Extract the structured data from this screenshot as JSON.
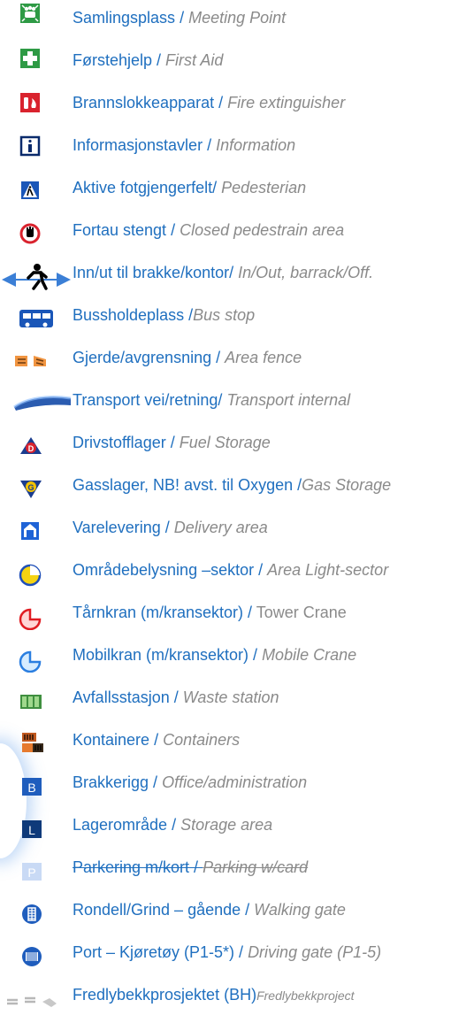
{
  "legend": {
    "items": [
      {
        "icon": "meeting-point-icon",
        "no": "Samlingsplass",
        "sep": " / ",
        "en": "Meeting Point"
      },
      {
        "icon": "first-aid-icon",
        "no": "Førstehjelp",
        "sep": " / ",
        "en": "First Aid"
      },
      {
        "icon": "fire-extinguisher-icon",
        "no": "Brannslokkeapparat",
        "sep": " / ",
        "en": "Fire extinguisher"
      },
      {
        "icon": "information-icon",
        "no": "Informasjonstavler",
        "sep": " / ",
        "en": "Information"
      },
      {
        "icon": "pedestrian-crossing-icon",
        "no": " Aktive fotgjengerfelt",
        "sep": "/ ",
        "en": "Pedesterian"
      },
      {
        "icon": "closed-pedestrian-icon",
        "no": "Fortau stengt",
        "sep": " / ",
        "en": "Closed pedestrain area"
      },
      {
        "icon": "walking-person-arrows-icon",
        "no": "Inn/ut til brakke/kontor",
        "sep": "/ ",
        "en": "In/Out, barrack/Off."
      },
      {
        "icon": "bus-icon",
        "no": "Bussholdeplass",
        "sep": " /",
        "en": "Bus stop"
      },
      {
        "icon": "fence-icon",
        "no": "Gjerde/avgrensning",
        "sep": " / ",
        "en": "Area fence"
      },
      {
        "icon": "transport-road-icon",
        "no": "Transport vei/retning",
        "sep": "/ ",
        "en": "Transport internal"
      },
      {
        "icon": "fuel-storage-icon",
        "no": "Drivstofflager",
        "sep": " / ",
        "en": "Fuel Storage"
      },
      {
        "icon": "gas-storage-icon",
        "no": "Gasslager, NB! avst. til Oxygen",
        "sep": " /",
        "en": "Gas Storage"
      },
      {
        "icon": "delivery-icon",
        "no": "Varelevering",
        "sep": " / ",
        "en": "Delivery area"
      },
      {
        "icon": "area-light-icon",
        "no": "Områdebelysning –sektor",
        "sep": " / ",
        "en": "Area Light-sector"
      },
      {
        "icon": "tower-crane-icon",
        "no": "Tårnkran (m/kransektor)",
        "sep": " / ",
        "en": "Tower Crane"
      },
      {
        "icon": "mobile-crane-icon",
        "no": "Mobilkran (m/kransektor)",
        "sep": " / ",
        "en": "Mobile Crane"
      },
      {
        "icon": "waste-station-icon",
        "no": "Avfallsstasjon",
        "sep": " / ",
        "en": "Waste station"
      },
      {
        "icon": "containers-icon",
        "no": "Kontainere",
        "sep": " / ",
        "en": "Containers"
      },
      {
        "icon": "office-b-icon",
        "letter": "B",
        "no": "Brakkerigg",
        "sep": " / ",
        "en": "Office/administration"
      },
      {
        "icon": "storage-l-icon",
        "letter": "L",
        "no": "Lagerområde",
        "sep": " / ",
        "en": "Storage area"
      },
      {
        "icon": "parking-p-icon",
        "letter": "P",
        "no": "Parkering m/kort",
        "sep": " / ",
        "en": "Parking w/card"
      },
      {
        "icon": "walking-gate-icon",
        "no": "Rondell/Grind – gående",
        "sep": " / ",
        "en": "Walking gate"
      },
      {
        "icon": "driving-gate-icon",
        "no": "Port – Kjøretøy (P1-5*)",
        "sep": " / ",
        "en": "Driving gate (P1-5)"
      },
      {
        "icon": "project-boundary-icon",
        "no": "Fredlybekkprosjektet (BH)",
        "sep": "",
        "en": "Fredlybekkproject"
      }
    ]
  },
  "colors": {
    "label_blue": "#1f6fbf",
    "label_grey": "#8a8a8a",
    "green": "#3aa13a",
    "red": "#d9232e",
    "navy": "#0a2a6b"
  }
}
